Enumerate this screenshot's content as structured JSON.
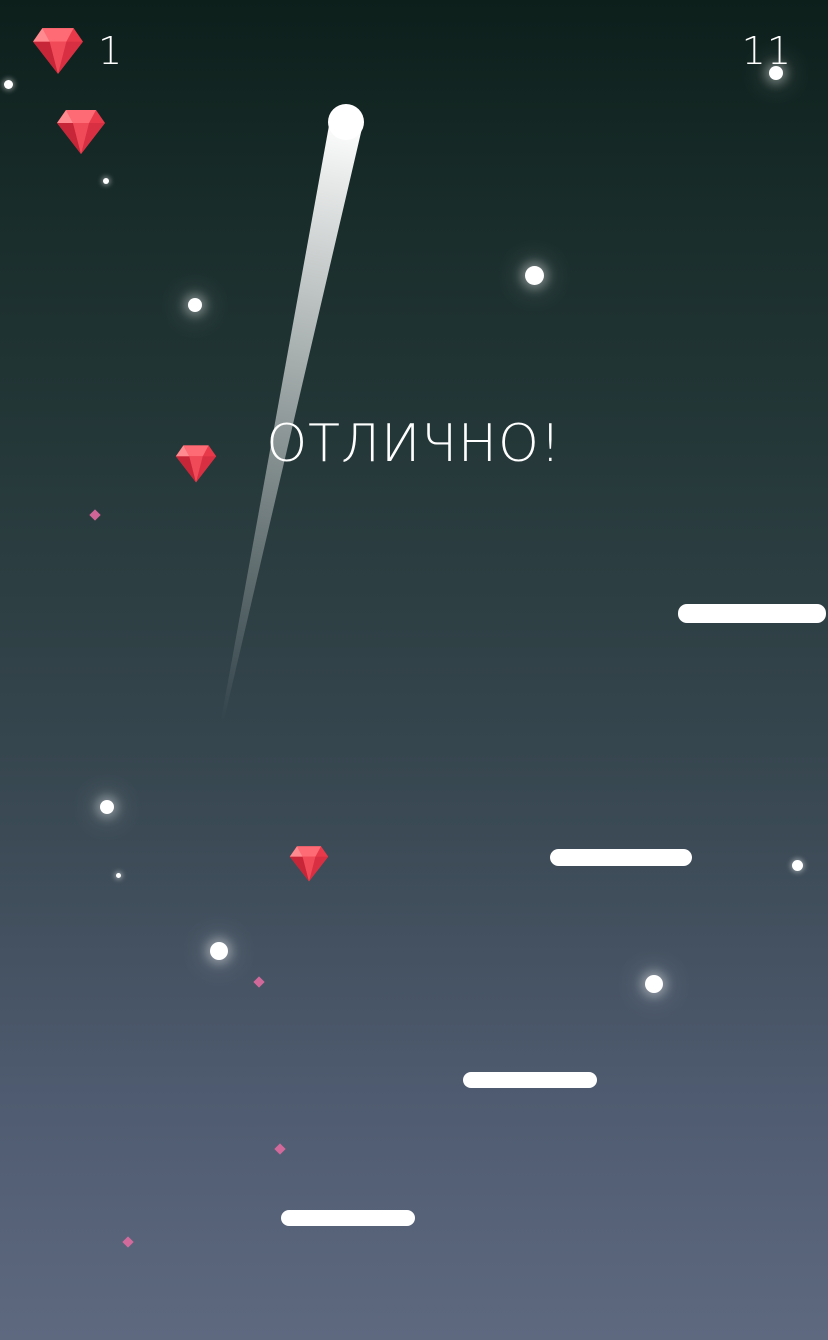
{
  "hud": {
    "gem_count": "1",
    "score": "11",
    "gem_icon": "red-diamond-icon"
  },
  "message": {
    "praise": "ОТЛИЧНО!"
  },
  "colors": {
    "gem_red": "#e8394a",
    "gem_highlight": "#ff7a80",
    "platform": "#ffffff",
    "ball": "#ffffff",
    "particle": "#e06aa0",
    "sky_top": "#0d1f1b",
    "sky_bottom": "#5e6980"
  }
}
